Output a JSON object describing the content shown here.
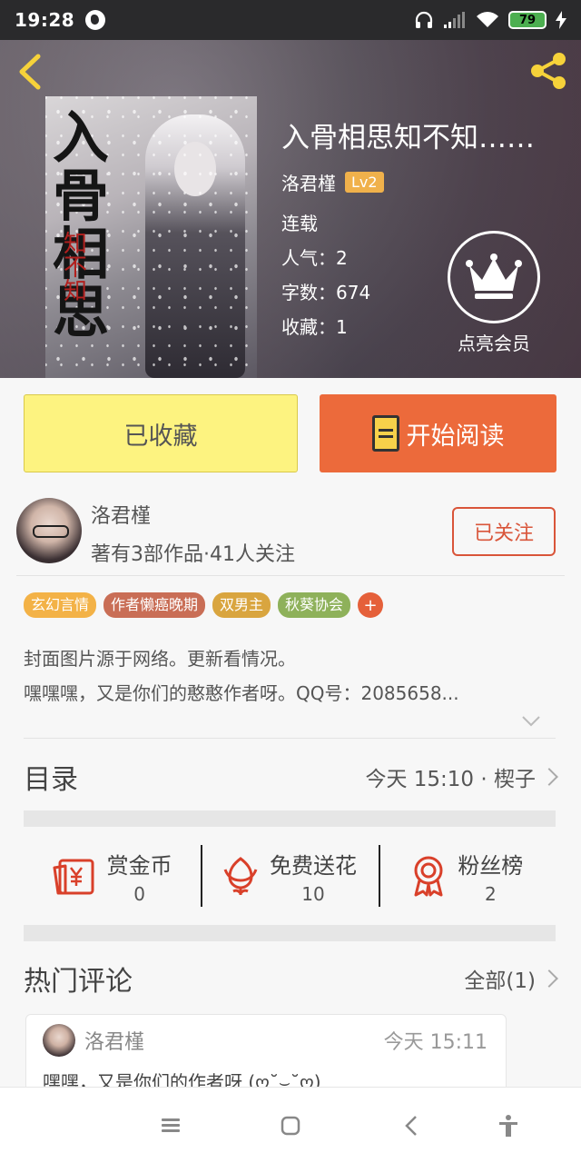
{
  "status_bar": {
    "time": "19:28",
    "battery": "79"
  },
  "book": {
    "cover_title": "入骨相思",
    "cover_subtitle": "知不知",
    "title": "入骨相思知不知……",
    "author": "洛君槿",
    "level": "Lv2",
    "status": "连载",
    "popularity": "人气：2",
    "word_count": "字数：674",
    "favorites": "收藏：1"
  },
  "vip": {
    "label": "点亮会员"
  },
  "actions": {
    "collected_label": "已收藏",
    "read_label": "开始阅读"
  },
  "author_section": {
    "name": "洛君槿",
    "meta": "著有3部作品·41人关注",
    "follow_label": "已关注"
  },
  "tags": [
    {
      "label": "玄幻言情",
      "color": "#f3b247"
    },
    {
      "label": "作者懒癌晚期",
      "color": "#c96e56"
    },
    {
      "label": "双男主",
      "color": "#d9a53f"
    },
    {
      "label": "秋葵协会",
      "color": "#8eb15a"
    }
  ],
  "tag_add": "+",
  "description": {
    "line1": "封面图片源于网络。更新看情况。",
    "line2": "嘿嘿嘿，又是你们的憨憨作者呀。QQ号：2085658..."
  },
  "catalog": {
    "title": "目录",
    "update": "今天 15:10 · 楔子"
  },
  "rewards": [
    {
      "label": "赏金币",
      "value": "0",
      "icon": "red-envelope-icon"
    },
    {
      "label": "免费送花",
      "value": "10",
      "icon": "flower-icon"
    },
    {
      "label": "粉丝榜",
      "value": "2",
      "icon": "medal-icon"
    }
  ],
  "comments": {
    "title": "热门评论",
    "all_label": "全部(1)",
    "items": [
      {
        "user": "洛君槿",
        "time": "今天 15:11",
        "text": "嘿嘿，又是你们的作者呀 (ღ˘⌣˘ღ)"
      }
    ]
  },
  "colors": {
    "accent_orange": "#ec6a3b",
    "collected_yellow": "#fdf380",
    "icon_red": "#d9402a",
    "badge_gold": "#f0b14b"
  }
}
